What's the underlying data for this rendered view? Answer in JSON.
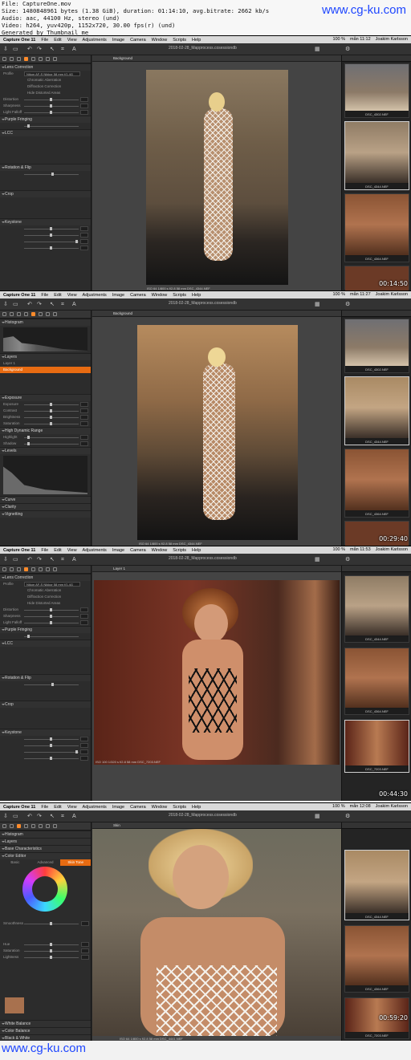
{
  "header": {
    "file": "File: CaptureOne.mov",
    "size": "Size: 1480848961 bytes (1.38 GiB), duration: 01:14:10, avg.bitrate: 2662 kb/s",
    "audio": "Audio: aac, 44100 Hz, stereo (und)",
    "video": "Video: h264, yuv420p, 1152x720, 30.00 fps(r) (und)",
    "generated": "Generated by Thumbnail me"
  },
  "watermark": "www.cg-ku.com",
  "menu": {
    "app": "Capture One 11",
    "items": [
      "File",
      "Edit",
      "View",
      "Adjustments",
      "Image",
      "Camera",
      "Window",
      "Scripts",
      "Help"
    ],
    "battery": "100 %",
    "user": "Joakim Karlsson"
  },
  "frames": [
    {
      "clock": "mån 11:12",
      "session": "2018-02-28_Mapprocess.cosessiondb",
      "viewer_label": "Background",
      "timestamp": "00:14:50",
      "viewer_info": "ISO 64    1/800 s    f/2.8    58 mm    DSC_4344.NEF",
      "tools": [
        {
          "title": "Lens Correction"
        },
        {
          "title": "Purple Fringing"
        },
        {
          "title": "LCC"
        },
        {
          "title": "Rotation & Flip"
        },
        {
          "title": "Crop"
        },
        {
          "title": "Keystone"
        }
      ],
      "lens_profile": "Nikon AF-S Nikkor 58 mm f/1.4G",
      "options": [
        "Chromatic Aberration",
        "Diffraction Correction",
        "Hide Distorted Areas"
      ],
      "sliders": [
        "Distortion",
        "Sharpness",
        "Light Falloff"
      ],
      "thumbs": [
        "DSC_4302.NEF",
        "DSC_4344.NEF",
        "DSC_4364.NEF"
      ]
    },
    {
      "clock": "mån 11:27",
      "session": "2018-02-28_Mapprocess.cosessiondb",
      "viewer_label": "Background",
      "timestamp": "00:29:40",
      "viewer_info": "ISO 64    1/800 s    f/2.8    58 mm    DSC_4344.NEF",
      "tools": [
        {
          "title": "Histogram"
        },
        {
          "title": "Layers"
        },
        {
          "title": "Exposure"
        },
        {
          "title": "High Dynamic Range"
        },
        {
          "title": "Levels"
        },
        {
          "title": "Curve"
        },
        {
          "title": "Clarity"
        },
        {
          "title": "Vignetting"
        }
      ],
      "layers": [
        "Layer 1",
        "Background"
      ],
      "sliders": [
        "Exposure",
        "Contrast",
        "Brightness",
        "Saturation"
      ],
      "hdr_sliders": [
        "Highlight",
        "Shadow"
      ],
      "thumbs": [
        "DSC_4302.NEF",
        "DSC_4344.NEF",
        "DSC_4364.NEF"
      ]
    },
    {
      "clock": "mån 11:53",
      "session": "2018-02-28_Mapprocess.cosessiondb",
      "viewer_label": "Layer 1",
      "timestamp": "00:44:30",
      "viewer_info": "ISO 100    1/320 s    f/2.8    58 mm    DSC_7203.NEF",
      "tools": [
        {
          "title": "Lens Correction"
        },
        {
          "title": "Purple Fringing"
        },
        {
          "title": "LCC"
        },
        {
          "title": "Rotation & Flip"
        },
        {
          "title": "Crop"
        },
        {
          "title": "Keystone"
        }
      ],
      "lens_profile": "Nikon AF-S Nikkor 58 mm f/1.4G",
      "options": [
        "Chromatic Aberration",
        "Diffraction Correction",
        "Hide Distorted Areas"
      ],
      "sliders": [
        "Distortion",
        "Sharpness",
        "Light Falloff"
      ],
      "thumbs": [
        "DSC_4344.NEF",
        "DSC_4364.NEF",
        "DSC_7203.NEF"
      ]
    },
    {
      "clock": "mån 12:08",
      "session": "2018-02-28_Mapprocess.cosessiondb",
      "viewer_label": "Skin",
      "timestamp": "00:59:20",
      "viewer_info": "ISO 64    1/800 s    f/2.8    58 mm    DSC_4441.NEF",
      "tools": [
        {
          "title": "Histogram"
        },
        {
          "title": "Layers"
        },
        {
          "title": "Base Characteristics"
        },
        {
          "title": "Color Editor"
        },
        {
          "title": "White Balance"
        },
        {
          "title": "Color Balance"
        },
        {
          "title": "Black & White"
        }
      ],
      "tabs": [
        "Basic",
        "Advanced",
        "Skin Tone"
      ],
      "sliders": [
        "Smoothness",
        "Hue",
        "Saturation",
        "Lightness"
      ],
      "thumbs": [
        "DSC_4344.NEF",
        "DSC_4364.NEF",
        "DSC_7203.NEF"
      ]
    }
  ]
}
